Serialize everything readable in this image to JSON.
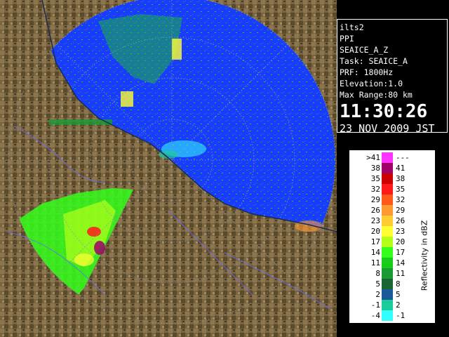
{
  "info": {
    "radar_name": "ilts2",
    "scan_type": "PPI",
    "product": "SEAICE_A_Z",
    "task": "Task: SEAICE_A",
    "prf": "PRF: 1800Hz",
    "elevation": "Elevation:1.0",
    "max_range": "Max Range:80 km",
    "time": "11:30:26",
    "date": "23 NOV 2009 JST"
  },
  "legend": {
    "title": "Reflectivity in dBZ",
    "rows": [
      {
        "lo": ">41",
        "hi": "---",
        "color": "#ff33ff"
      },
      {
        "lo": "38",
        "hi": "41",
        "color": "#a0006a"
      },
      {
        "lo": "35",
        "hi": "38",
        "color": "#cc0000"
      },
      {
        "lo": "32",
        "hi": "35",
        "color": "#ff1a1a"
      },
      {
        "lo": "29",
        "hi": "32",
        "color": "#ff5a1a"
      },
      {
        "lo": "26",
        "hi": "29",
        "color": "#ff9a33"
      },
      {
        "lo": "23",
        "hi": "26",
        "color": "#ffcc33"
      },
      {
        "lo": "20",
        "hi": "23",
        "color": "#ffff33"
      },
      {
        "lo": "17",
        "hi": "20",
        "color": "#b3ff1a"
      },
      {
        "lo": "14",
        "hi": "17",
        "color": "#33ff1a"
      },
      {
        "lo": "11",
        "hi": "14",
        "color": "#1acc1a"
      },
      {
        "lo": "8",
        "hi": "11",
        "color": "#1a9a33"
      },
      {
        "lo": "5",
        "hi": "8",
        "color": "#1a6633"
      },
      {
        "lo": "2",
        "hi": "5",
        "color": "#1a5a99"
      },
      {
        "lo": "-1",
        "hi": "2",
        "color": "#1acc99"
      },
      {
        "lo": "-4",
        "hi": "-1",
        "color": "#33ffff"
      }
    ]
  },
  "colors": {
    "sea_echo": "#1a3cff",
    "land": "#6b5a3a",
    "background": "#000000"
  }
}
